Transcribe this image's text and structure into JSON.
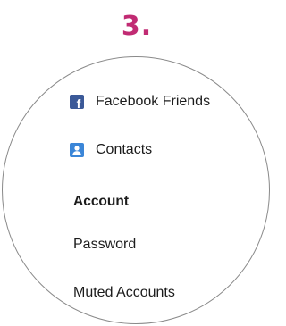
{
  "step": {
    "number": "3.",
    "color": "#c12b73"
  },
  "menu": {
    "items": [
      {
        "label": "Facebook Friends",
        "icon": "facebook-icon",
        "icon_color": "#3b5998"
      },
      {
        "label": "Contacts",
        "icon": "contacts-icon",
        "icon_color": "#3b86d8"
      }
    ],
    "section": {
      "header": "Account",
      "items": [
        {
          "label": "Password"
        },
        {
          "label": "Muted Accounts"
        }
      ]
    }
  }
}
